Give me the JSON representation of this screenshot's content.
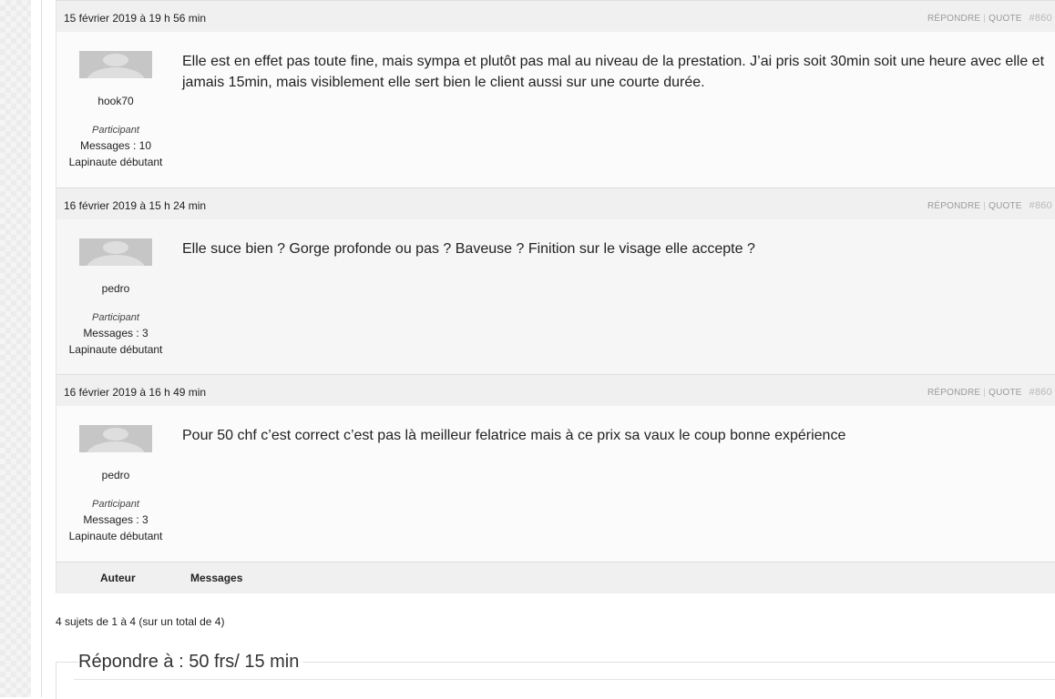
{
  "replies": [
    {
      "date": "15 février 2019 à 19 h 56 min",
      "actions": {
        "reply": "RÉPONDRE",
        "quote": "QUOTE",
        "permalink": "#860"
      },
      "author": {
        "name": "hook70",
        "role": "Participant",
        "count": "Messages : 10",
        "rank": "Lapinaute débutant"
      },
      "text": "Elle est en effet pas toute fine, mais sympa et plutôt pas mal au niveau de la prestation. J’ai pris soit 30min soit une heure avec elle et jamais 15min, mais visiblement elle sert bien le client aussi sur une courte durée."
    },
    {
      "date": "16 février 2019 à 15 h 24 min",
      "actions": {
        "reply": "RÉPONDRE",
        "quote": "QUOTE",
        "permalink": "#860"
      },
      "author": {
        "name": "pedro",
        "role": "Participant",
        "count": "Messages : 3",
        "rank": "Lapinaute débutant"
      },
      "text": "Elle suce bien ? Gorge profonde ou pas ? Baveuse ? Finition sur le visage elle accepte ?"
    },
    {
      "date": "16 février 2019 à 16 h 49 min",
      "actions": {
        "reply": "RÉPONDRE",
        "quote": "QUOTE",
        "permalink": "#860"
      },
      "author": {
        "name": "pedro",
        "role": "Participant",
        "count": "Messages : 3",
        "rank": "Lapinaute débutant"
      },
      "text": "Pour 50 chf c’est correct c’est pas là meilleur felatrice mais à ce prix sa vaux le coup bonne expérience"
    }
  ],
  "table_footer": {
    "author": "Auteur",
    "messages": "Messages"
  },
  "pagination": {
    "count": "4 sujets de 1 à 4 (sur un total de 4)"
  },
  "reply_form": {
    "title": "Répondre à : 50 frs/ 15 min"
  }
}
